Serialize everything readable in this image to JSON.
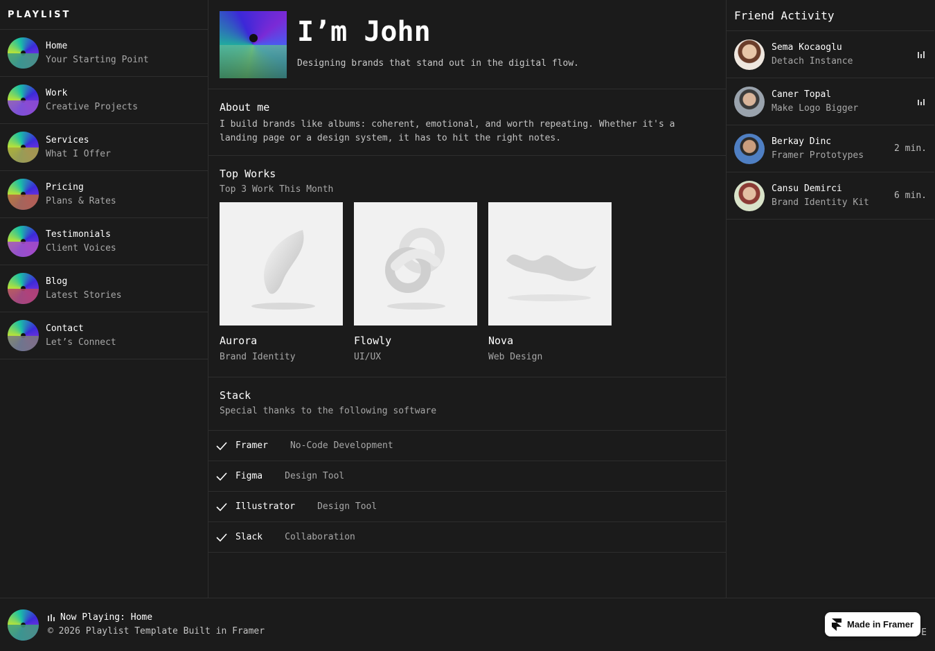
{
  "sidebar": {
    "title": "PLAYLIST",
    "items": [
      {
        "title": "Home",
        "subtitle": "Your Starting Point"
      },
      {
        "title": "Work",
        "subtitle": "Creative Projects"
      },
      {
        "title": "Services",
        "subtitle": "What I Offer"
      },
      {
        "title": "Pricing",
        "subtitle": "Plans & Rates"
      },
      {
        "title": "Testimonials",
        "subtitle": "Client Voices"
      },
      {
        "title": "Blog",
        "subtitle": "Latest Stories"
      },
      {
        "title": "Contact",
        "subtitle": "Let’s Connect"
      }
    ]
  },
  "hero": {
    "title": "I’m John",
    "subtitle": "Designing brands that stand out in the digital flow."
  },
  "about": {
    "title": "About me",
    "body": "I build brands like albums: coherent, emotional, and worth repeating. Whether it's a landing page or a design system, it has to hit the right notes."
  },
  "works": {
    "title": "Top Works",
    "subtitle": "Top 3 Work This Month",
    "items": [
      {
        "name": "Aurora",
        "category": "Brand Identity"
      },
      {
        "name": "Flowly",
        "category": "UI/UX"
      },
      {
        "name": "Nova",
        "category": "Web Design"
      }
    ]
  },
  "stack": {
    "title": "Stack",
    "subtitle": "Special thanks to the following software",
    "items": [
      {
        "name": "Framer",
        "desc": "No-Code Development"
      },
      {
        "name": "Figma",
        "desc": "Design Tool"
      },
      {
        "name": "Illustrator",
        "desc": "Design Tool"
      },
      {
        "name": "Slack",
        "desc": "Collaboration"
      }
    ]
  },
  "friends": {
    "title": "Friend Activity",
    "items": [
      {
        "name": "Sema Kocaoglu",
        "track": "Detach Instance",
        "status": ""
      },
      {
        "name": "Caner Topal",
        "track": "Make Logo Bigger",
        "status": ""
      },
      {
        "name": "Berkay Dinc",
        "track": "Framer Prototypes",
        "status": "2 min."
      },
      {
        "name": "Cansu Demirci",
        "track": "Brand Identity Kit",
        "status": "6 min."
      }
    ]
  },
  "footer": {
    "now_playing": "Now Playing: Home",
    "copyright": "© 2026 Playlist Template Built in Framer",
    "right_text": "E"
  },
  "badge": {
    "label": "Made in Framer"
  },
  "colors": {
    "background": "#1b1b1b",
    "border": "#2e2e2e",
    "text": "#ffffff",
    "muted": "#a8a8a8"
  },
  "icons": {
    "check": "check-icon",
    "equalizer": "equalizer-icon",
    "framer": "framer-logo-icon"
  }
}
